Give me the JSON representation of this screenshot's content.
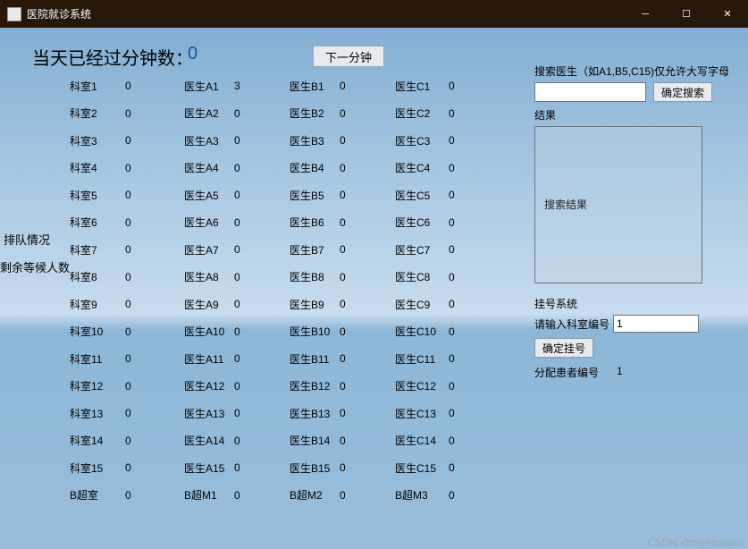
{
  "titlebar": {
    "title": "医院就诊系统"
  },
  "header": {
    "minutes_label": "当天已经过分钟数：",
    "minutes_value": "0",
    "next_button": "下一分钟"
  },
  "side": {
    "label1": "排队情况",
    "label2": "剩余等候人数"
  },
  "rows": [
    {
      "c1": "科室1",
      "v1": "0",
      "c2": "医生A1",
      "v2": "3",
      "c3": "医生B1",
      "v3": "0",
      "c4": "医生C1",
      "v4": "0"
    },
    {
      "c1": "科室2",
      "v1": "0",
      "c2": "医生A2",
      "v2": "0",
      "c3": "医生B2",
      "v3": "0",
      "c4": "医生C2",
      "v4": "0"
    },
    {
      "c1": "科室3",
      "v1": "0",
      "c2": "医生A3",
      "v2": "0",
      "c3": "医生B3",
      "v3": "0",
      "c4": "医生C3",
      "v4": "0"
    },
    {
      "c1": "科室4",
      "v1": "0",
      "c2": "医生A4",
      "v2": "0",
      "c3": "医生B4",
      "v3": "0",
      "c4": "医生C4",
      "v4": "0"
    },
    {
      "c1": "科室5",
      "v1": "0",
      "c2": "医生A5",
      "v2": "0",
      "c3": "医生B5",
      "v3": "0",
      "c4": "医生C5",
      "v4": "0"
    },
    {
      "c1": "科室6",
      "v1": "0",
      "c2": "医生A6",
      "v2": "0",
      "c3": "医生B6",
      "v3": "0",
      "c4": "医生C6",
      "v4": "0"
    },
    {
      "c1": "科室7",
      "v1": "0",
      "c2": "医生A7",
      "v2": "0",
      "c3": "医生B7",
      "v3": "0",
      "c4": "医生C7",
      "v4": "0"
    },
    {
      "c1": "科室8",
      "v1": "0",
      "c2": "医生A8",
      "v2": "0",
      "c3": "医生B8",
      "v3": "0",
      "c4": "医生C8",
      "v4": "0"
    },
    {
      "c1": "科室9",
      "v1": "0",
      "c2": "医生A9",
      "v2": "0",
      "c3": "医生B9",
      "v3": "0",
      "c4": "医生C9",
      "v4": "0"
    },
    {
      "c1": "科室10",
      "v1": "0",
      "c2": "医生A10",
      "v2": "0",
      "c3": "医生B10",
      "v3": "0",
      "c4": "医生C10",
      "v4": "0"
    },
    {
      "c1": "科室11",
      "v1": "0",
      "c2": "医生A11",
      "v2": "0",
      "c3": "医生B11",
      "v3": "0",
      "c4": "医生C11",
      "v4": "0"
    },
    {
      "c1": "科室12",
      "v1": "0",
      "c2": "医生A12",
      "v2": "0",
      "c3": "医生B12",
      "v3": "0",
      "c4": "医生C12",
      "v4": "0"
    },
    {
      "c1": "科室13",
      "v1": "0",
      "c2": "医生A13",
      "v2": "0",
      "c3": "医生B13",
      "v3": "0",
      "c4": "医生C13",
      "v4": "0"
    },
    {
      "c1": "科室14",
      "v1": "0",
      "c2": "医生A14",
      "v2": "0",
      "c3": "医生B14",
      "v3": "0",
      "c4": "医生C14",
      "v4": "0"
    },
    {
      "c1": "科室15",
      "v1": "0",
      "c2": "医生A15",
      "v2": "0",
      "c3": "医生B15",
      "v3": "0",
      "c4": "医生C15",
      "v4": "0"
    },
    {
      "c1": "B超室",
      "v1": "0",
      "c2": "B超M1",
      "v2": "0",
      "c3": "B超M2",
      "v3": "0",
      "c4": "B超M3",
      "v4": "0"
    }
  ],
  "search": {
    "hint": "搜索医生（如A1,B5,C15)仅允许大写字母",
    "button": "确定搜索",
    "result_label": "结果",
    "result_placeholder": "搜索结果"
  },
  "register": {
    "title": "挂号系统",
    "room_label": "请输入科室编号",
    "room_value": "1",
    "button": "确定挂号",
    "assign_label": "分配患者编号",
    "assign_value": "1"
  },
  "watermark": "CSDN @biyezuopin"
}
